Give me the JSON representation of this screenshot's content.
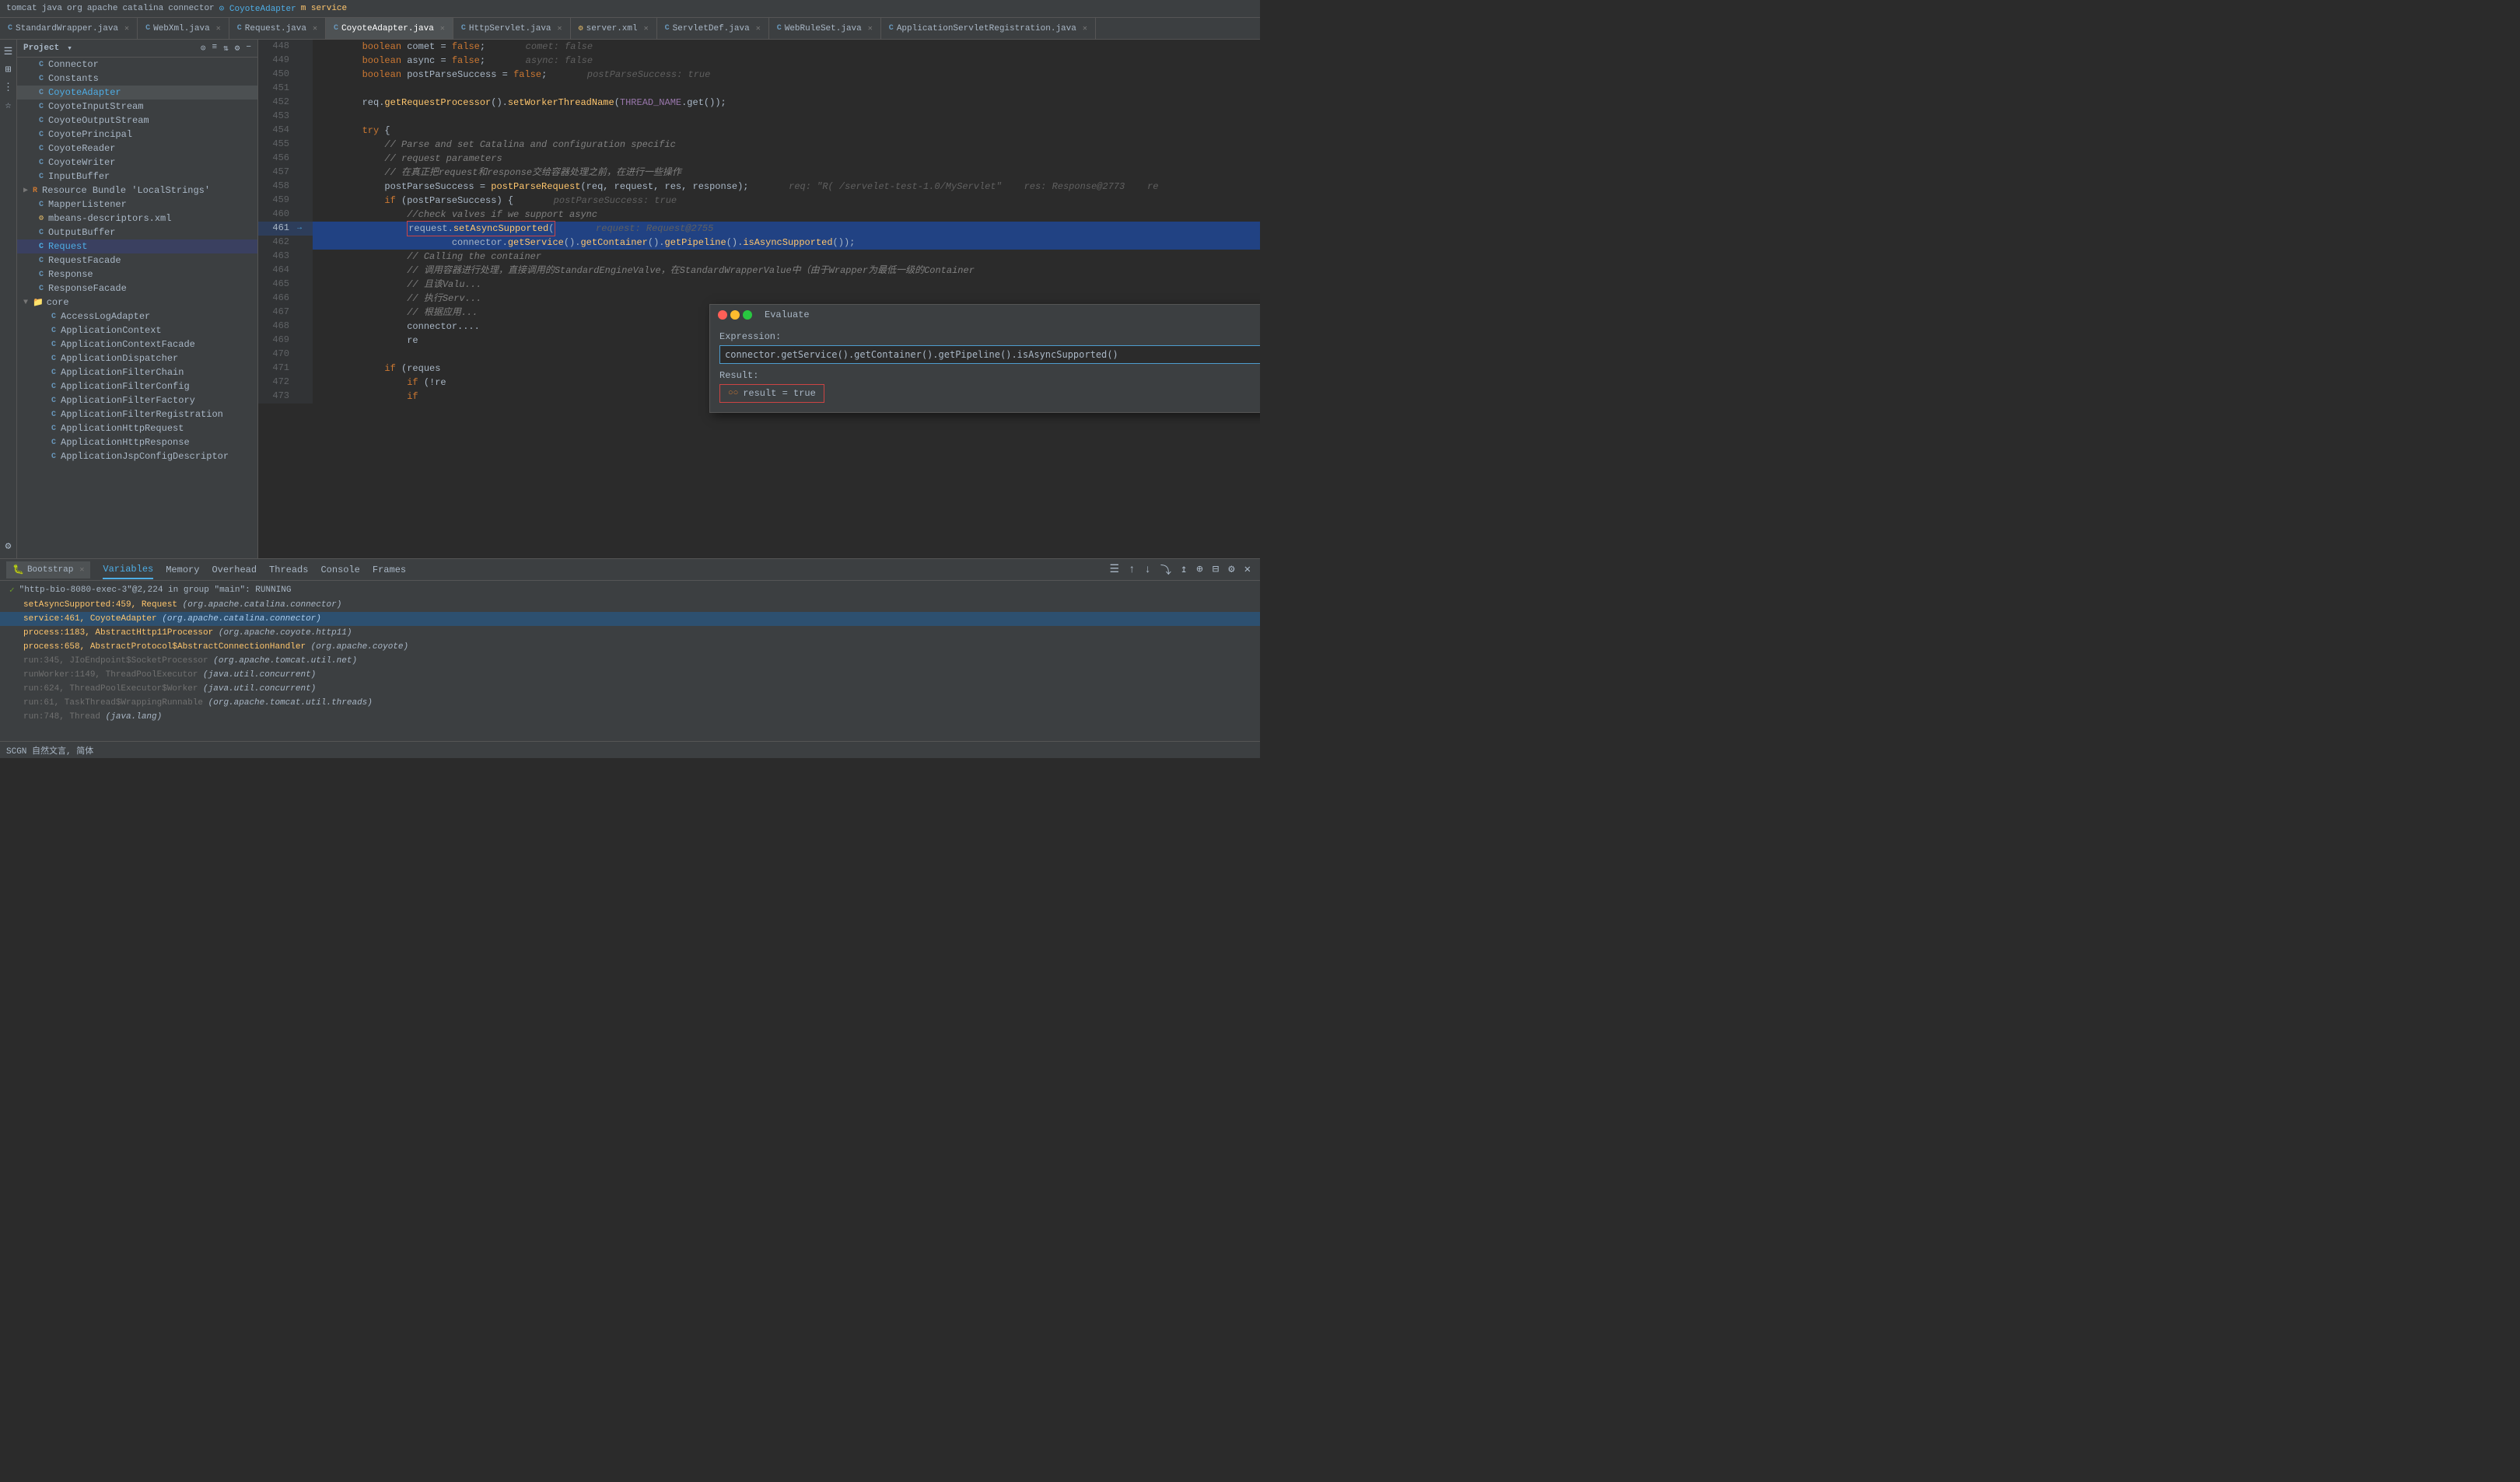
{
  "topbar": {
    "breadcrumbs": [
      "tomcat",
      "java",
      "org",
      "apache",
      "catalina",
      "connector",
      "CoyoteAdapter",
      "service"
    ],
    "separators": [
      " ",
      " ",
      " ",
      " ",
      " ",
      " ",
      " "
    ]
  },
  "tabs": [
    {
      "label": "StandardWrapper.java",
      "type": "C",
      "active": false
    },
    {
      "label": "WebXml.java",
      "type": "C",
      "active": false
    },
    {
      "label": "Request.java",
      "type": "C",
      "active": false
    },
    {
      "label": "CoyoteAdapter.java",
      "type": "C",
      "active": true
    },
    {
      "label": "HttpServlet.java",
      "type": "C",
      "active": false
    },
    {
      "label": "server.xml",
      "type": "X",
      "active": false
    },
    {
      "label": "ServletDef.java",
      "type": "C",
      "active": false
    },
    {
      "label": "WebRuleSet.java",
      "type": "C",
      "active": false
    },
    {
      "label": "ApplicationServletRegistration.java",
      "type": "C",
      "active": false
    }
  ],
  "sidebar": {
    "title": "Project",
    "items": [
      {
        "name": "Connector",
        "type": "C",
        "indent": 1
      },
      {
        "name": "Constants",
        "type": "C",
        "indent": 1
      },
      {
        "name": "CoyoteAdapter",
        "type": "C",
        "indent": 1,
        "selected": true
      },
      {
        "name": "CoyoteInputStream",
        "type": "C",
        "indent": 1
      },
      {
        "name": "CoyoteOutputStream",
        "type": "C",
        "indent": 1
      },
      {
        "name": "CoyotePrincipal",
        "type": "C",
        "indent": 1
      },
      {
        "name": "CoyoteReader",
        "type": "C",
        "indent": 1
      },
      {
        "name": "CoyoteWriter",
        "type": "C",
        "indent": 1
      },
      {
        "name": "InputBuffer",
        "type": "C",
        "indent": 1
      },
      {
        "name": "Resource Bundle 'LocalStrings'",
        "type": "R",
        "indent": 1,
        "expandable": true
      },
      {
        "name": "MapperListener",
        "type": "C",
        "indent": 1
      },
      {
        "name": "mbeans-descriptors.xml",
        "type": "X",
        "indent": 1
      },
      {
        "name": "OutputBuffer",
        "type": "C",
        "indent": 1
      },
      {
        "name": "Request",
        "type": "C",
        "indent": 1,
        "highlighted": true
      },
      {
        "name": "RequestFacade",
        "type": "C",
        "indent": 1
      },
      {
        "name": "Response",
        "type": "C",
        "indent": 1
      },
      {
        "name": "ResponseFacade",
        "type": "C",
        "indent": 1
      },
      {
        "name": "core",
        "type": "folder",
        "indent": 1,
        "expandable": true,
        "expanded": true
      },
      {
        "name": "AccessLogAdapter",
        "type": "C",
        "indent": 2
      },
      {
        "name": "ApplicationContext",
        "type": "C",
        "indent": 2
      },
      {
        "name": "ApplicationContextFacade",
        "type": "C",
        "indent": 2
      },
      {
        "name": "ApplicationDispatcher",
        "type": "C",
        "indent": 2
      },
      {
        "name": "ApplicationFilterChain",
        "type": "C",
        "indent": 2
      },
      {
        "name": "ApplicationFilterConfig",
        "type": "C",
        "indent": 2
      },
      {
        "name": "ApplicationFilterFactory",
        "type": "C",
        "indent": 2
      },
      {
        "name": "ApplicationFilterRegistration",
        "type": "C",
        "indent": 2
      },
      {
        "name": "ApplicationHttpRequest",
        "type": "C",
        "indent": 2
      },
      {
        "name": "ApplicationHttpResponse",
        "type": "C",
        "indent": 2
      },
      {
        "name": "ApplicationJspConfigDescriptor",
        "type": "C",
        "indent": 2
      }
    ]
  },
  "code": {
    "lines": [
      {
        "num": 448,
        "content": "        boolean comet = false;",
        "hint": "comet: false"
      },
      {
        "num": 449,
        "content": "        boolean async = false;",
        "hint": "async: false"
      },
      {
        "num": 450,
        "content": "        boolean postParseSuccess = false;",
        "hint": "postParseSuccess: true"
      },
      {
        "num": 451,
        "content": ""
      },
      {
        "num": 452,
        "content": "        req.getRequestProcessor().setWorkerThreadName(THREAD_NAME.get());"
      },
      {
        "num": 453,
        "content": ""
      },
      {
        "num": 454,
        "content": "        try {"
      },
      {
        "num": 455,
        "content": "            // Parse and set Catalina and configuration specific"
      },
      {
        "num": 456,
        "content": "            // request parameters"
      },
      {
        "num": 457,
        "content": "            // 在真正把request和response交给容器处理之前，在进行一些操作"
      },
      {
        "num": 458,
        "content": "            postParseSuccess = postParseRequest(req, request, res, response);",
        "hint": "req: \"R( /servelet-test-1.0/MyServlet\"    res: Response@2773    re"
      },
      {
        "num": 459,
        "content": "            if (postParseSuccess) {",
        "hint": "postParseSuccess: true"
      },
      {
        "num": 460,
        "content": "                //check valves if we support async"
      },
      {
        "num": 461,
        "content": "                request.setAsyncSupported(",
        "selected": true,
        "hint": "request: Request@2755"
      },
      {
        "num": 462,
        "content": "                        connector.getService().getContainer().getPipeline().isAsyncSupported());",
        "selected": true
      },
      {
        "num": 463,
        "content": "                // Calling the container"
      },
      {
        "num": 464,
        "content": "                // 调用容器进行处理，直接调用的StandardEngineValve，在StandardWrapperValue中（由于Wrapper为最低一级的Container"
      },
      {
        "num": 465,
        "content": "                // 且该Valu..."
      },
      {
        "num": 466,
        "content": "                // 执行Serv..."
      },
      {
        "num": 467,
        "content": "                // 根据应用..."
      },
      {
        "num": 468,
        "content": "                connector...."
      },
      {
        "num": 469,
        "content": "                re"
      },
      {
        "num": 470,
        "content": ""
      },
      {
        "num": 471,
        "content": "            if (reques"
      },
      {
        "num": 472,
        "content": "                if (!re"
      },
      {
        "num": 473,
        "content": "                if"
      }
    ]
  },
  "evaluate_popup": {
    "title": "Evaluate",
    "expression_label": "Expression:",
    "expression_value": "connector.getService().getContainer().getPipeline().isAsyncSupported()",
    "result_label": "Result:",
    "result_value": "result = true",
    "result_icon": "○○"
  },
  "debug": {
    "tab_name": "Bootstrap",
    "tabs": [
      "Variables",
      "Memory",
      "Overhead",
      "Threads",
      "Console",
      "Frames"
    ],
    "active_tab": "Variables",
    "stack_frames": [
      {
        "func": "setAsyncSupported:459, Request",
        "org": "(org.apache.catalina.connector)",
        "state": "check",
        "selected": false
      },
      {
        "func": "service:461, CoyoteAdapter",
        "org": "(org.apache.catalina.connector)",
        "state": "current",
        "selected": true
      },
      {
        "func": "process:1183, AbstractHttp11Processor",
        "org": "(org.apache.coyote.http11)",
        "state": "normal",
        "selected": false
      },
      {
        "func": "process:658, AbstractProtocol$AbstractConnectionHandler",
        "org": "(org.apache.coyote)",
        "state": "normal",
        "selected": false
      },
      {
        "func": "run:345, JIoEndpoint$SocketProcessor",
        "org": "(org.apache.tomcat.util.net)",
        "state": "grayed",
        "selected": false
      },
      {
        "func": "runWorker:1149, ThreadPoolExecutor",
        "org": "(java.util.concurrent)",
        "state": "grayed",
        "selected": false
      },
      {
        "func": "run:624, ThreadPoolExecutor$Worker",
        "org": "(java.util.concurrent)",
        "state": "grayed",
        "selected": false
      },
      {
        "func": "run:61, TaskThread$WrappingRunnable",
        "org": "(org.apache.tomcat.util.threads)",
        "state": "grayed",
        "selected": false
      },
      {
        "func": "run:748, Thread",
        "org": "(java.lang)",
        "state": "grayed",
        "selected": false
      }
    ],
    "running_thread": "\"http-bio-8080-exec-3\"@2,224 in group \"main\": RUNNING"
  },
  "statusbar": {
    "left": "SCGN 自然文言, 简体"
  }
}
